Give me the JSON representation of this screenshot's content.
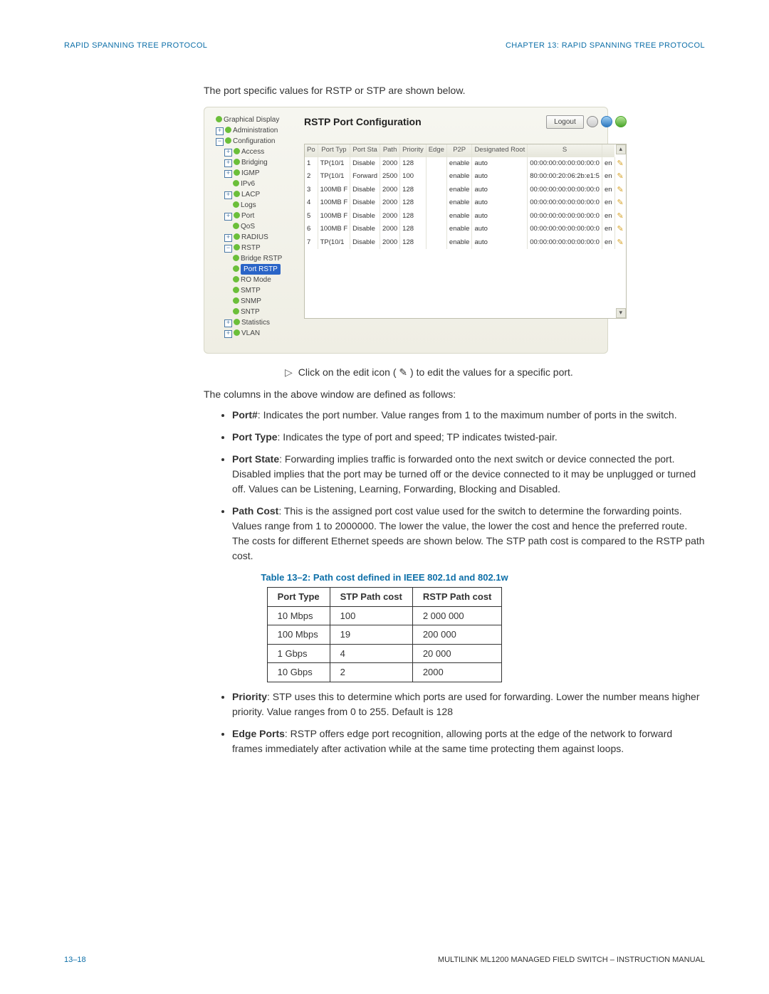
{
  "header": {
    "left": "RAPID SPANNING TREE PROTOCOL",
    "right": "CHAPTER 13: RAPID SPANNING TREE PROTOCOL"
  },
  "intro": "The port specific values for RSTP or STP are shown below.",
  "win": {
    "title": "RSTP Port Configuration",
    "logout": "Logout",
    "nav": [
      {
        "lv": 0,
        "exp": "",
        "dot": true,
        "label": "Graphical Display"
      },
      {
        "lv": 0,
        "exp": "+",
        "dot": true,
        "label": "Administration"
      },
      {
        "lv": 0,
        "exp": "−",
        "dot": true,
        "label": "Configuration"
      },
      {
        "lv": 1,
        "exp": "+",
        "dot": true,
        "label": "Access"
      },
      {
        "lv": 1,
        "exp": "+",
        "dot": true,
        "label": "Bridging"
      },
      {
        "lv": 1,
        "exp": "+",
        "dot": true,
        "label": "IGMP"
      },
      {
        "lv": 2,
        "exp": "",
        "dot": true,
        "label": "IPv6"
      },
      {
        "lv": 1,
        "exp": "+",
        "dot": true,
        "label": "LACP"
      },
      {
        "lv": 2,
        "exp": "",
        "dot": true,
        "label": "Logs"
      },
      {
        "lv": 1,
        "exp": "+",
        "dot": true,
        "label": "Port"
      },
      {
        "lv": 2,
        "exp": "",
        "dot": true,
        "label": "QoS"
      },
      {
        "lv": 1,
        "exp": "+",
        "dot": true,
        "label": "RADIUS"
      },
      {
        "lv": 1,
        "exp": "−",
        "dot": true,
        "label": "RSTP"
      },
      {
        "lv": 2,
        "exp": "",
        "dot": true,
        "label": "Bridge RSTP"
      },
      {
        "lv": 2,
        "exp": "",
        "dot": true,
        "label": "Port RSTP",
        "sel": true
      },
      {
        "lv": 2,
        "exp": "",
        "dot": true,
        "label": "RO Mode"
      },
      {
        "lv": 2,
        "exp": "",
        "dot": true,
        "label": "SMTP"
      },
      {
        "lv": 2,
        "exp": "",
        "dot": true,
        "label": "SNMP"
      },
      {
        "lv": 2,
        "exp": "",
        "dot": true,
        "label": "SNTP"
      },
      {
        "lv": 1,
        "exp": "+",
        "dot": true,
        "label": "Statistics"
      },
      {
        "lv": 1,
        "exp": "+",
        "dot": true,
        "label": "VLAN"
      }
    ],
    "cols": [
      "Po",
      "Port Typ",
      "Port Sta",
      "Path",
      "Priority",
      "Edge",
      "P2P",
      "Designated Root",
      "S",
      ""
    ],
    "rows": [
      [
        "1",
        "TP(10/1",
        "Disable",
        "2000",
        "128",
        "",
        "enable",
        "auto",
        "00:00:00:00:00:00:00:0",
        "en",
        "✎"
      ],
      [
        "2",
        "TP(10/1",
        "Forward",
        "2500",
        "100",
        "",
        "enable",
        "auto",
        "80:00:00:20:06:2b:e1:5",
        "en",
        "✎"
      ],
      [
        "3",
        "100MB F",
        "Disable",
        "2000",
        "128",
        "",
        "enable",
        "auto",
        "00:00:00:00:00:00:00:0",
        "en",
        "✎"
      ],
      [
        "4",
        "100MB F",
        "Disable",
        "2000",
        "128",
        "",
        "enable",
        "auto",
        "00:00:00:00:00:00:00:0",
        "en",
        "✎"
      ],
      [
        "5",
        "100MB F",
        "Disable",
        "2000",
        "128",
        "",
        "enable",
        "auto",
        "00:00:00:00:00:00:00:0",
        "en",
        "✎"
      ],
      [
        "6",
        "100MB F",
        "Disable",
        "2000",
        "128",
        "",
        "enable",
        "auto",
        "00:00:00:00:00:00:00:0",
        "en",
        "✎"
      ],
      [
        "7",
        "TP(10/1",
        "Disable",
        "2000",
        "128",
        "",
        "enable",
        "auto",
        "00:00:00:00:00:00:00:0",
        "en",
        "✎"
      ]
    ]
  },
  "clickline": "Click on the edit icon ( ✎ ) to edit the values for a specific port.",
  "colsdef_intro": "The columns in the above window are defined as follows:",
  "defs": [
    {
      "t": "Port#",
      "d": ": Indicates the port number. Value ranges from 1 to the maximum number of ports in the switch."
    },
    {
      "t": "Port Type",
      "d": ": Indicates the type of port and speed; TP indicates twisted-pair."
    },
    {
      "t": "Port State",
      "d": ": Forwarding implies traffic is forwarded onto the next switch or device connected the port. Disabled implies that the port may be turned off or the device connected to it may be unplugged or turned off. Values can be Listening, Learning, Forwarding, Blocking and Disabled."
    },
    {
      "t": "Path Cost",
      "d": ": This is the assigned port cost value used for the switch to determine the forwarding points. Values range from 1 to 2000000. The lower the value, the lower the cost and hence the preferred route. The costs for different Ethernet speeds are shown below. The STP path cost  is compared to the RSTP path cost."
    }
  ],
  "table_caption": "Table 13–2: Path cost defined in IEEE 802.1d and 802.1w",
  "chart_data": {
    "type": "table",
    "columns": [
      "Port Type",
      "STP Path cost",
      "RSTP Path cost"
    ],
    "rows": [
      [
        "10 Mbps",
        "100",
        "2 000 000"
      ],
      [
        "100 Mbps",
        "19",
        "200 000"
      ],
      [
        "1 Gbps",
        "4",
        "20 000"
      ],
      [
        "10 Gbps",
        "2",
        "2000"
      ]
    ]
  },
  "defs2": [
    {
      "t": "Priority",
      "d": ": STP uses this to determine which ports are used for forwarding. Lower the number means higher priority. Value ranges from 0 to 255. Default is 128"
    },
    {
      "t": "Edge Ports",
      "d": ": RSTP offers edge port recognition, allowing ports at the edge of the network to forward frames immediately after activation while at the same time protecting them against loops."
    }
  ],
  "footer": {
    "page": "13–18",
    "doc": "MULTILINK ML1200 MANAGED FIELD SWITCH – INSTRUCTION MANUAL"
  }
}
